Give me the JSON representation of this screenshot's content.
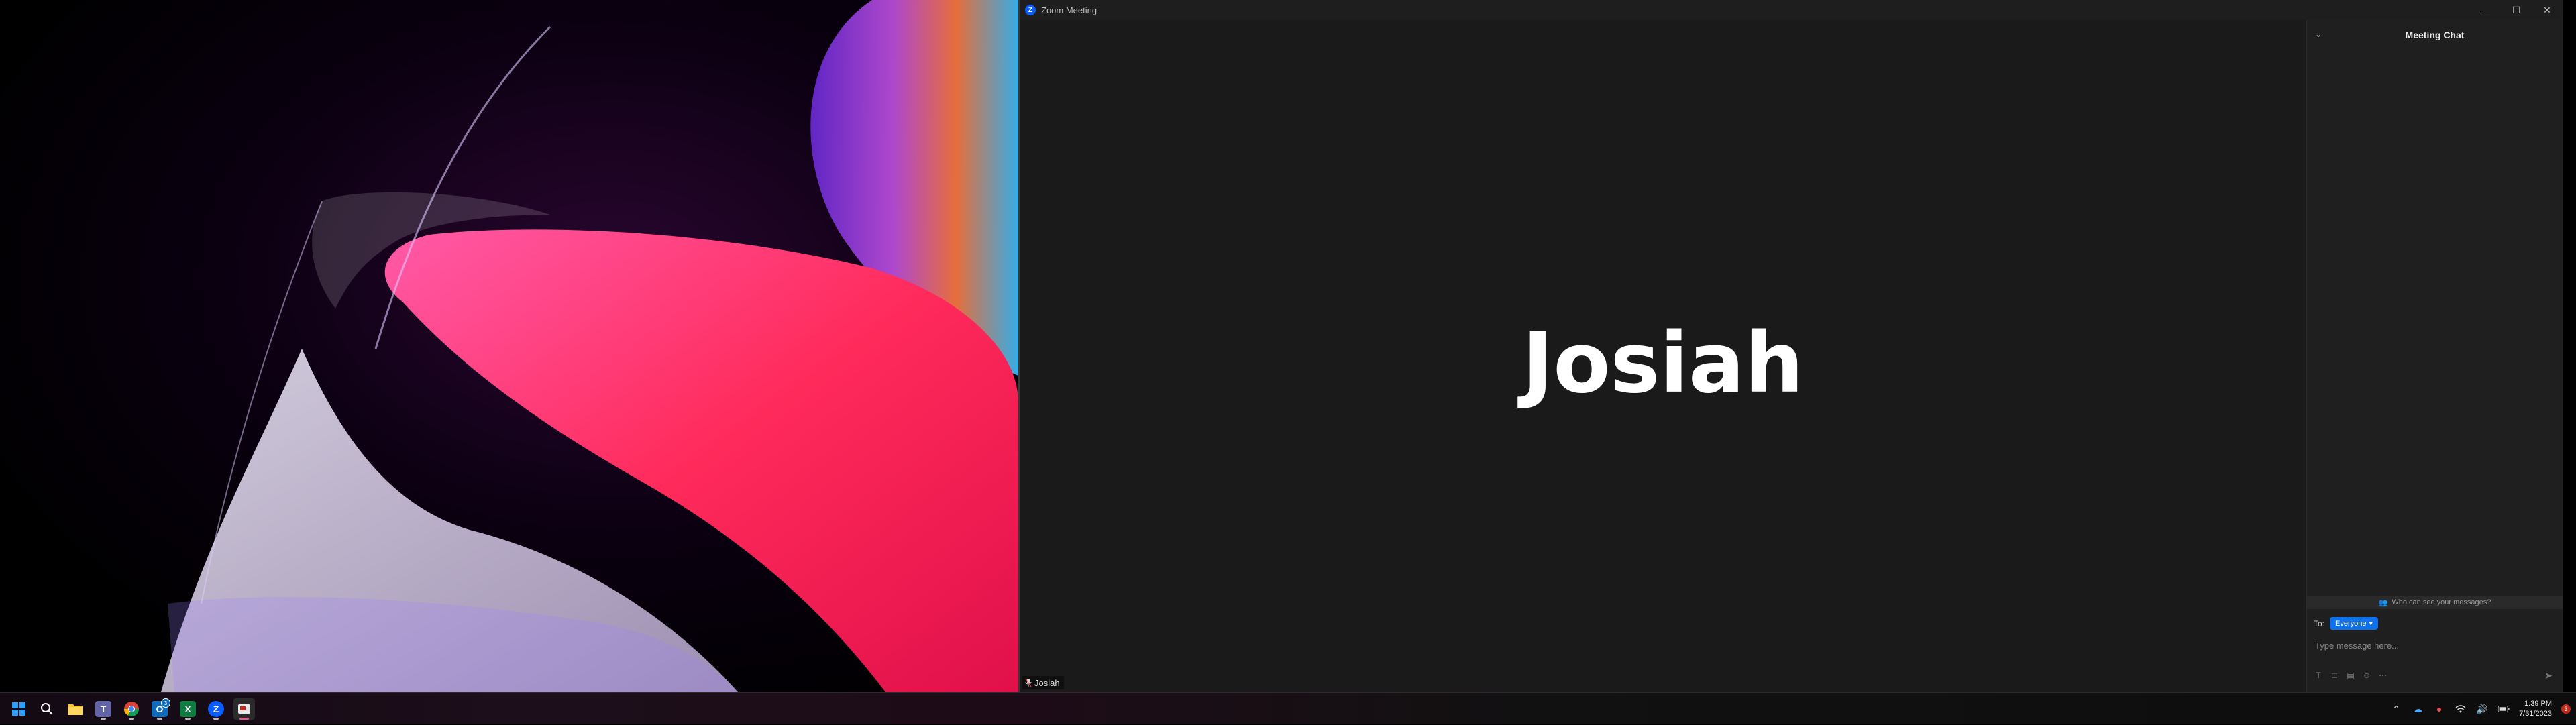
{
  "window": {
    "title": "Zoom Meeting",
    "logo_letter": "Z"
  },
  "video": {
    "participant_name": "Josiah",
    "participant_tag": "Josiah"
  },
  "chat": {
    "title": "Meeting Chat",
    "visibility_prompt": "Who can see your messages?",
    "to_label": "To:",
    "recipient": "Everyone",
    "input_placeholder": "Type message here..."
  },
  "taskbar": {
    "apps": [
      {
        "name": "start-menu-icon",
        "color": "#0a84ff"
      },
      {
        "name": "search-icon",
        "color": "#ffffff"
      },
      {
        "name": "file-explorer-icon",
        "color": "#f4c430"
      },
      {
        "name": "teams-icon",
        "color": "#6264a7"
      },
      {
        "name": "chrome-icon",
        "color": "#34a853"
      },
      {
        "name": "outlook-icon",
        "color": "#0f6cbd"
      },
      {
        "name": "excel-icon",
        "color": "#107c41"
      },
      {
        "name": "zoom-icon",
        "color": "#0b5cff"
      },
      {
        "name": "snipping-tool-icon",
        "color": "#cccccc"
      }
    ],
    "outlook_badge": "3",
    "clock_time": "1:39 PM",
    "clock_date": "7/31/2023",
    "notification_count": "3"
  }
}
